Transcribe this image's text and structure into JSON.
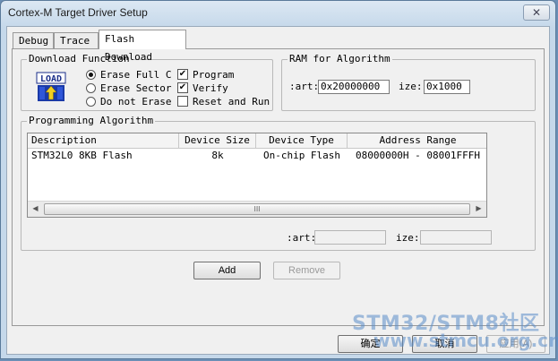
{
  "window": {
    "title": "Cortex-M Target Driver Setup",
    "close_glyph": "✕"
  },
  "tabs": [
    {
      "label": "Debug"
    },
    {
      "label": "Trace"
    },
    {
      "label": "Flash Download",
      "active": true
    }
  ],
  "download_function": {
    "label": "Download Function",
    "icon": "load-icon",
    "icon_text": "LOAD",
    "erase_options": [
      {
        "label": "Erase Full C",
        "selected": true
      },
      {
        "label": "Erase Sector",
        "selected": false
      },
      {
        "label": "Do not Erase",
        "selected": false
      }
    ],
    "options": [
      {
        "label": "Program",
        "checked": true
      },
      {
        "label": "Verify",
        "checked": true
      },
      {
        "label": "Reset and Run",
        "checked": false
      }
    ],
    "check_glyph": "✔"
  },
  "ram": {
    "label": "RAM for Algorithm",
    "start_label": ":art:",
    "start_value": "0x20000000",
    "size_label": "ize:",
    "size_value": "0x1000"
  },
  "programming": {
    "label": "Programming Algorithm",
    "columns": [
      "Description",
      "Device Size",
      "Device Type",
      "Address Range"
    ],
    "rows": [
      {
        "description": "STM32L0 8KB Flash",
        "size": "8k",
        "type": "On-chip Flash",
        "range": "08000000H - 08001FFFH"
      }
    ],
    "scroll_left": "◀",
    "scroll_right": "▶",
    "scroll_grip": "III",
    "start_label": ":art:",
    "start_value": "",
    "size_label": "ize:",
    "size_value": "",
    "add_label": "Add",
    "remove_label": "Remove"
  },
  "footer": {
    "ok_label": "确定",
    "cancel_label": "取消",
    "apply_label": "应用(A)"
  },
  "watermark": {
    "line1": "STM32/STM8社区",
    "line2": "www.stmcu.org.cn"
  },
  "colors": {
    "accent": "#3399ff",
    "watermark": "#5a8cc8"
  }
}
